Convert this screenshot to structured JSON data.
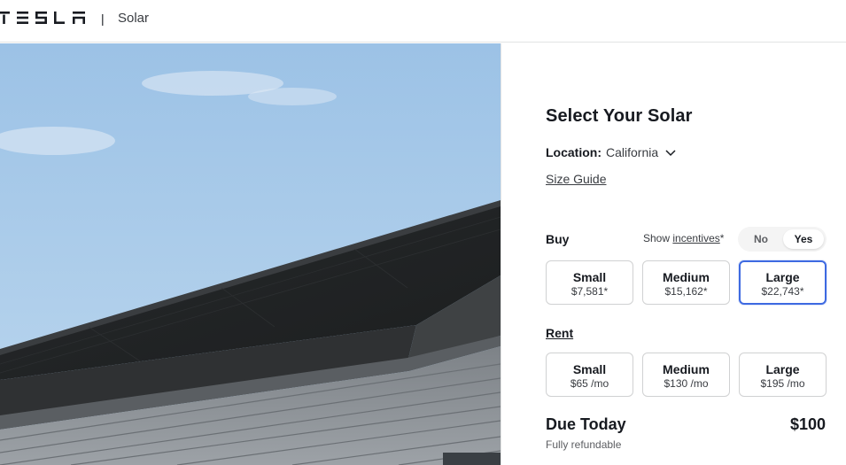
{
  "header": {
    "logo_text": "TESLA",
    "separator": "|",
    "product": "Solar"
  },
  "panel": {
    "title": "Select Your Solar",
    "location": {
      "label": "Location:",
      "value": "California"
    },
    "size_guide": "Size Guide",
    "buy": {
      "label": "Buy",
      "show_incentives_prefix": "Show",
      "incentives_link": "incentives",
      "incentives_suffix": "*",
      "toggle": {
        "no": "No",
        "yes": "Yes",
        "selected": "Yes"
      },
      "options": [
        {
          "name": "Small",
          "price": "$7,581*"
        },
        {
          "name": "Medium",
          "price": "$15,162*"
        },
        {
          "name": "Large",
          "price": "$22,743*"
        }
      ],
      "selected": "Large"
    },
    "rent": {
      "label": "Rent",
      "options": [
        {
          "name": "Small",
          "price": "$65 /mo"
        },
        {
          "name": "Medium",
          "price": "$130 /mo"
        },
        {
          "name": "Large",
          "price": "$195 /mo"
        }
      ]
    },
    "due": {
      "label": "Due Today",
      "value": "$100",
      "note": "Fully refundable"
    }
  },
  "colors": {
    "accent": "#3e6ae1",
    "text": "#171a20",
    "sky": "#a9cce8",
    "roof": "#2a2c2d",
    "siding": "#8d9297"
  },
  "icons": {
    "logo": "tesla-wordmark",
    "location_chevron": "chevron-down-icon"
  }
}
